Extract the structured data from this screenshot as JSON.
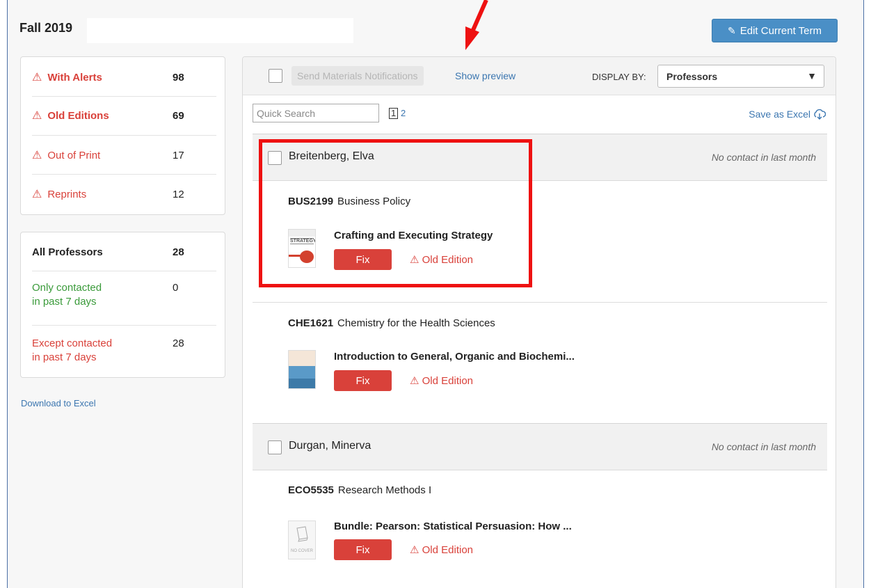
{
  "term": {
    "title": "Fall 2019",
    "edit_label": "Edit Current Term"
  },
  "alerts": [
    {
      "label": "With Alerts",
      "count": "98"
    },
    {
      "label": "Old Editions",
      "count": "69"
    },
    {
      "label": "Out of Print",
      "count": "17"
    },
    {
      "label": "Reprints",
      "count": "12"
    }
  ],
  "professors_filter": [
    {
      "label": "All Professors",
      "count": "28"
    },
    {
      "label_line1": "Only contacted",
      "label_line2": "in past 7 days",
      "count": "0"
    },
    {
      "label_line1": "Except contacted",
      "label_line2": "in past 7 days",
      "count": "28"
    }
  ],
  "download_label": "Download to Excel",
  "toolbar": {
    "send_label": "Send Materials Notifications",
    "preview_label": "Show preview",
    "display_by_label": "DISPLAY BY:",
    "display_by_value": "Professors"
  },
  "search": {
    "placeholder": "Quick Search"
  },
  "pages": [
    "1",
    "2"
  ],
  "save_excel_label": "Save as Excel",
  "professors": [
    {
      "name": "Breitenberg, Elva",
      "contact_status": "No contact in last month",
      "courses": [
        {
          "code": "BUS2199",
          "name": "Business Policy",
          "book": "Crafting and Executing Strategy",
          "fix": "Fix",
          "alert": "Old Edition"
        },
        {
          "code": "CHE1621",
          "name": "Chemistry for the Health Sciences",
          "book": "Introduction to General, Organic and Biochemi...",
          "fix": "Fix",
          "alert": "Old Edition"
        }
      ]
    },
    {
      "name": "Durgan, Minerva",
      "contact_status": "No contact in last month",
      "courses": [
        {
          "code": "ECO5535",
          "name": "Research Methods I",
          "book": "Bundle: Pearson: Statistical Persuasion: How ...",
          "fix": "Fix",
          "alert": "Old Edition",
          "cover_text": "NO COVER"
        }
      ]
    }
  ],
  "colors": {
    "alert_red": "#d9413a",
    "link_blue": "#3b76b0",
    "button_blue": "#4a8fc6",
    "highlight_red": "#ee1111"
  }
}
